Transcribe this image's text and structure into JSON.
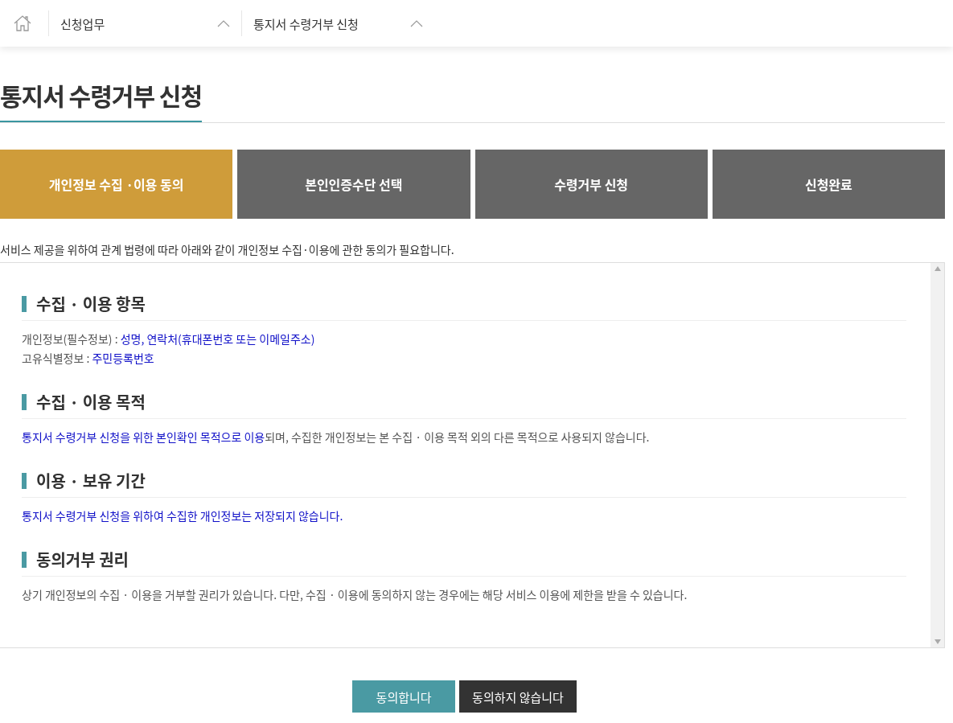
{
  "breadcrumb": [
    {
      "label": "신청업무"
    },
    {
      "label": "통지서 수령거부 신청"
    }
  ],
  "title": "통지서 수령거부 신청",
  "steps": [
    {
      "label": "개인정보 수집 ·이용 동의",
      "selected": true
    },
    {
      "label": "본인인증수단 선택",
      "selected": false
    },
    {
      "label": "수령거부 신청",
      "selected": false
    },
    {
      "label": "신청완료",
      "selected": false
    }
  ],
  "intro": "서비스 제공을 위하여 관계 법령에 따라 아래와 같이 개인정보 수집·이용에 관한 동의가 필요합니다.",
  "sections": [
    {
      "heading": "수집 · 이용 항목",
      "lines": [
        [
          {
            "text": "개인정보(필수정보) : ",
            "highlight": false
          },
          {
            "text": "성명, 연락처(휴대폰번호 또는 이메일주소)",
            "highlight": true
          }
        ],
        [
          {
            "text": "고유식별정보 : ",
            "highlight": false
          },
          {
            "text": "주민등록번호",
            "highlight": true
          }
        ]
      ]
    },
    {
      "heading": "수집 · 이용 목적",
      "lines": [
        [
          {
            "text": "통지서 수령거부 신청을 위한 본인확인 목적으로 이용",
            "highlight": true
          },
          {
            "text": "되며, 수집한 개인정보는 본 수집 · 이용 목적 외의 다른 목적으로 사용되지 않습니다.",
            "highlight": false
          }
        ]
      ]
    },
    {
      "heading": "이용 · 보유 기간",
      "lines": [
        [
          {
            "text": "통지서 수령거부 신청을 위하여 수집한 개인정보는 저장되지 않습니다.",
            "highlight": true
          }
        ]
      ]
    },
    {
      "heading": "동의거부 권리",
      "lines": [
        [
          {
            "text": "상기 개인정보의 수집 · 이용을 거부할 권리가 있습니다.  다만,  수집 · 이용에 동의하지 않는 경우에는 해당 서비스 이용에 제한을 받을 수 있습니다.",
            "highlight": false
          }
        ]
      ]
    }
  ],
  "buttons": [
    {
      "label": "동의합니다",
      "kind": "primary"
    },
    {
      "label": "동의하지 않습니다",
      "kind": "secondary"
    }
  ]
}
